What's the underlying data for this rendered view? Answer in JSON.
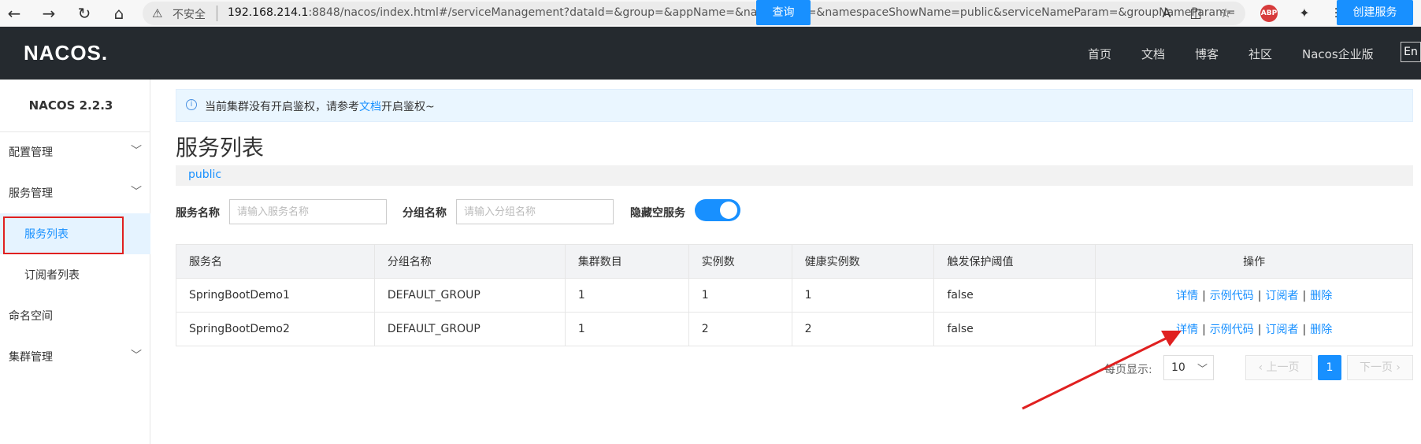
{
  "browser": {
    "security_label": "不安全",
    "url_host": "192.168.214.1",
    "url_rest": ":8848/nacos/index.html#/serviceManagement?dataId=&group=&appName=&namespace=&namespaceShowName=public&serviceNameParam=&groupNameParam="
  },
  "topnav": {
    "logo": "NACOS.",
    "items": [
      "首页",
      "文档",
      "博客",
      "社区",
      "Nacos企业版"
    ],
    "lang": "En"
  },
  "sidebar": {
    "version": "NACOS 2.2.3",
    "items": [
      {
        "label": "配置管理"
      },
      {
        "label": "服务管理"
      },
      {
        "label": "服务列表"
      },
      {
        "label": "订阅者列表"
      },
      {
        "label": "命名空间"
      },
      {
        "label": "集群管理"
      }
    ]
  },
  "notice": {
    "before": "当前集群没有开启鉴权，请参考",
    "link": "文档",
    "after": "开启鉴权~"
  },
  "page": {
    "title": "服务列表",
    "namespace": "public"
  },
  "filters": {
    "service_label": "服务名称",
    "service_placeholder": "请输入服务名称",
    "group_label": "分组名称",
    "group_placeholder": "请输入分组名称",
    "hide_empty_label": "隐藏空服务",
    "hide_empty_on": true,
    "query_button": "查询",
    "create_button": "创建服务"
  },
  "table": {
    "headers": [
      "服务名",
      "分组名称",
      "集群数目",
      "实例数",
      "健康实例数",
      "触发保护阈值",
      "操作"
    ],
    "rows": [
      [
        "SpringBootDemo1",
        "DEFAULT_GROUP",
        "1",
        "1",
        "1",
        "false"
      ],
      [
        "SpringBootDemo2",
        "DEFAULT_GROUP",
        "1",
        "2",
        "2",
        "false"
      ]
    ],
    "ops": [
      "详情",
      "示例代码",
      "订阅者",
      "删除"
    ]
  },
  "pagination": {
    "page_size_label": "每页显示:",
    "page_size": "10",
    "prev": "上一页",
    "next": "下一页",
    "current": "1"
  },
  "colors": {
    "primary": "#1890ff",
    "nav_bg": "#252a2f",
    "annotation": "#e02020"
  }
}
